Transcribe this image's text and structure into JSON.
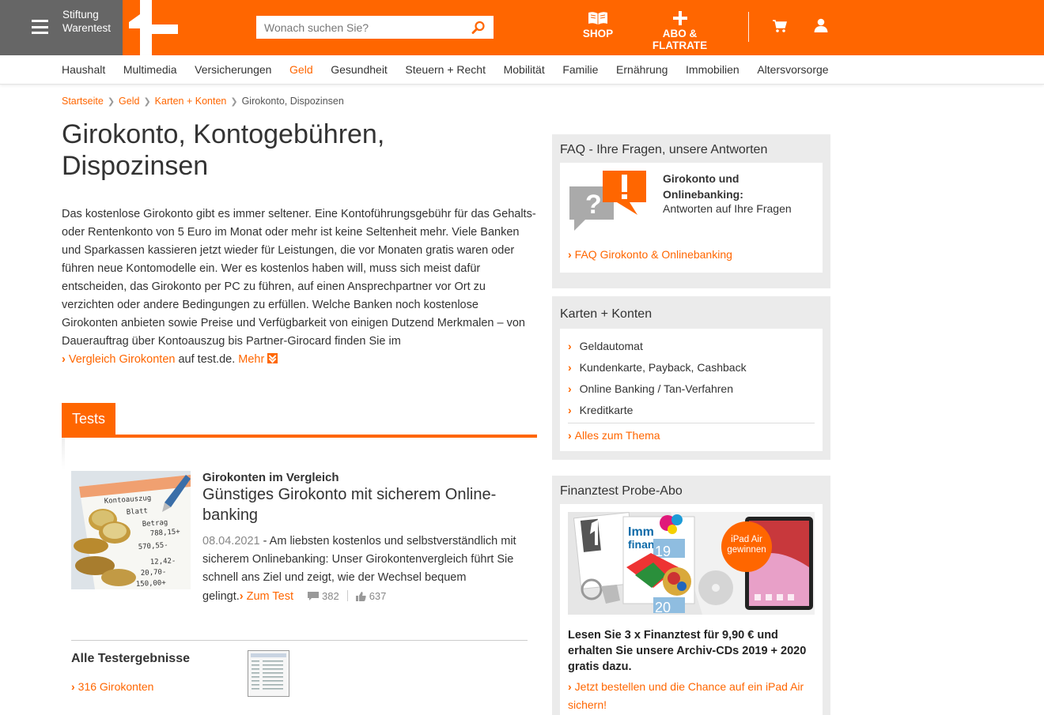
{
  "header": {
    "brand_line1": "Stiftung",
    "brand_line2": "Warentest",
    "search_placeholder": "Wonach suchen Sie?",
    "shop_label": "SHOP",
    "abo_label": "ABO & FLATRATE",
    "accent_color": "#ff6600"
  },
  "nav": {
    "items": [
      "Haushalt",
      "Multimedia",
      "Versicherungen",
      "Geld",
      "Gesundheit",
      "Steuern + Recht",
      "Mobilität",
      "Familie",
      "Ernährung",
      "Immobilien",
      "Altersvorsorge"
    ],
    "active": "Geld"
  },
  "breadcrumb": {
    "items": [
      "Startseite",
      "Geld",
      "Karten + Konten"
    ],
    "current": "Girokonto, Dispozinsen"
  },
  "page": {
    "title": "Girokonto, Kontogebühren, Dispozinsen",
    "intro": "Das kostenlose Girokonto gibt es immer seltener. Eine Kontoführungsgebühr für das Gehalts- oder Rentenkonto von 5 Euro im Monat oder mehr ist keine Seltenheit mehr. Viele Banken und Sparkassen kassieren jetzt wieder für Leistungen, die vor Monaten gratis waren oder führen neue Kontomodelle ein. Wer es kostenlos haben will, muss sich meist dafür entscheiden, das Girokonto per PC zu führen, auf einen Ansprechpartner vor Ort zu verzichten oder andere Bedingungen zu erfüllen. Welche Banken noch kostenlose Girokonten anbieten sowie Preise und Verfügbarkeit von einigen Dutzend Merkmalen – von Dauerauftrag über Kontoauszug bis Partner-Girocard finden Sie im",
    "intro_link": "Vergleich Girokonten",
    "intro_suffix": "auf test.de.",
    "more_label": "Mehr"
  },
  "tests": {
    "tab_label": "Tests",
    "card": {
      "kicker": "Girokonten im Vergleich",
      "title": "Günstiges Girokonto mit sicherem Online-banking",
      "date": "08.04.2021",
      "text": "- Am liebsten kostenlos und selbstverständlich mit sicherem Onlinebanking: Unser Girokontenvergleich führt Sie schnell ans Ziel und zeigt, wie der Wechsel bequem gelingt.",
      "link": "Zum Test",
      "comments": "382",
      "likes": "637"
    },
    "all_results_label": "Alle Testergebnisse",
    "all_results_link": "316 Girokonten"
  },
  "sidebar": {
    "faq": {
      "heading": "FAQ - Ihre Fragen, unsere Antworten",
      "title": "Girokonto und Onlinebanking:",
      "subtitle": "Antworten auf Ihre Fragen",
      "link": "FAQ Girokonto & Onlinebanking"
    },
    "karten": {
      "heading": "Karten + Konten",
      "items": [
        "Geldautomat",
        "Kundenkarte, Payback, Cashback",
        "Online Banking / Tan-Verfahren",
        "Kreditkarte"
      ],
      "all_link": "Alles zum Thema"
    },
    "abo": {
      "heading": "Finanztest Probe-Abo",
      "badge": "iPad Air gewinnen",
      "text": "Lesen Sie 3 x Finanztest für 9,90 € und erhalten Sie unsere Archiv-CDs 2019 + 2020 gratis dazu.",
      "link": "Jetzt bestellen und die Chance auf ein iPad Air sichern!"
    }
  }
}
